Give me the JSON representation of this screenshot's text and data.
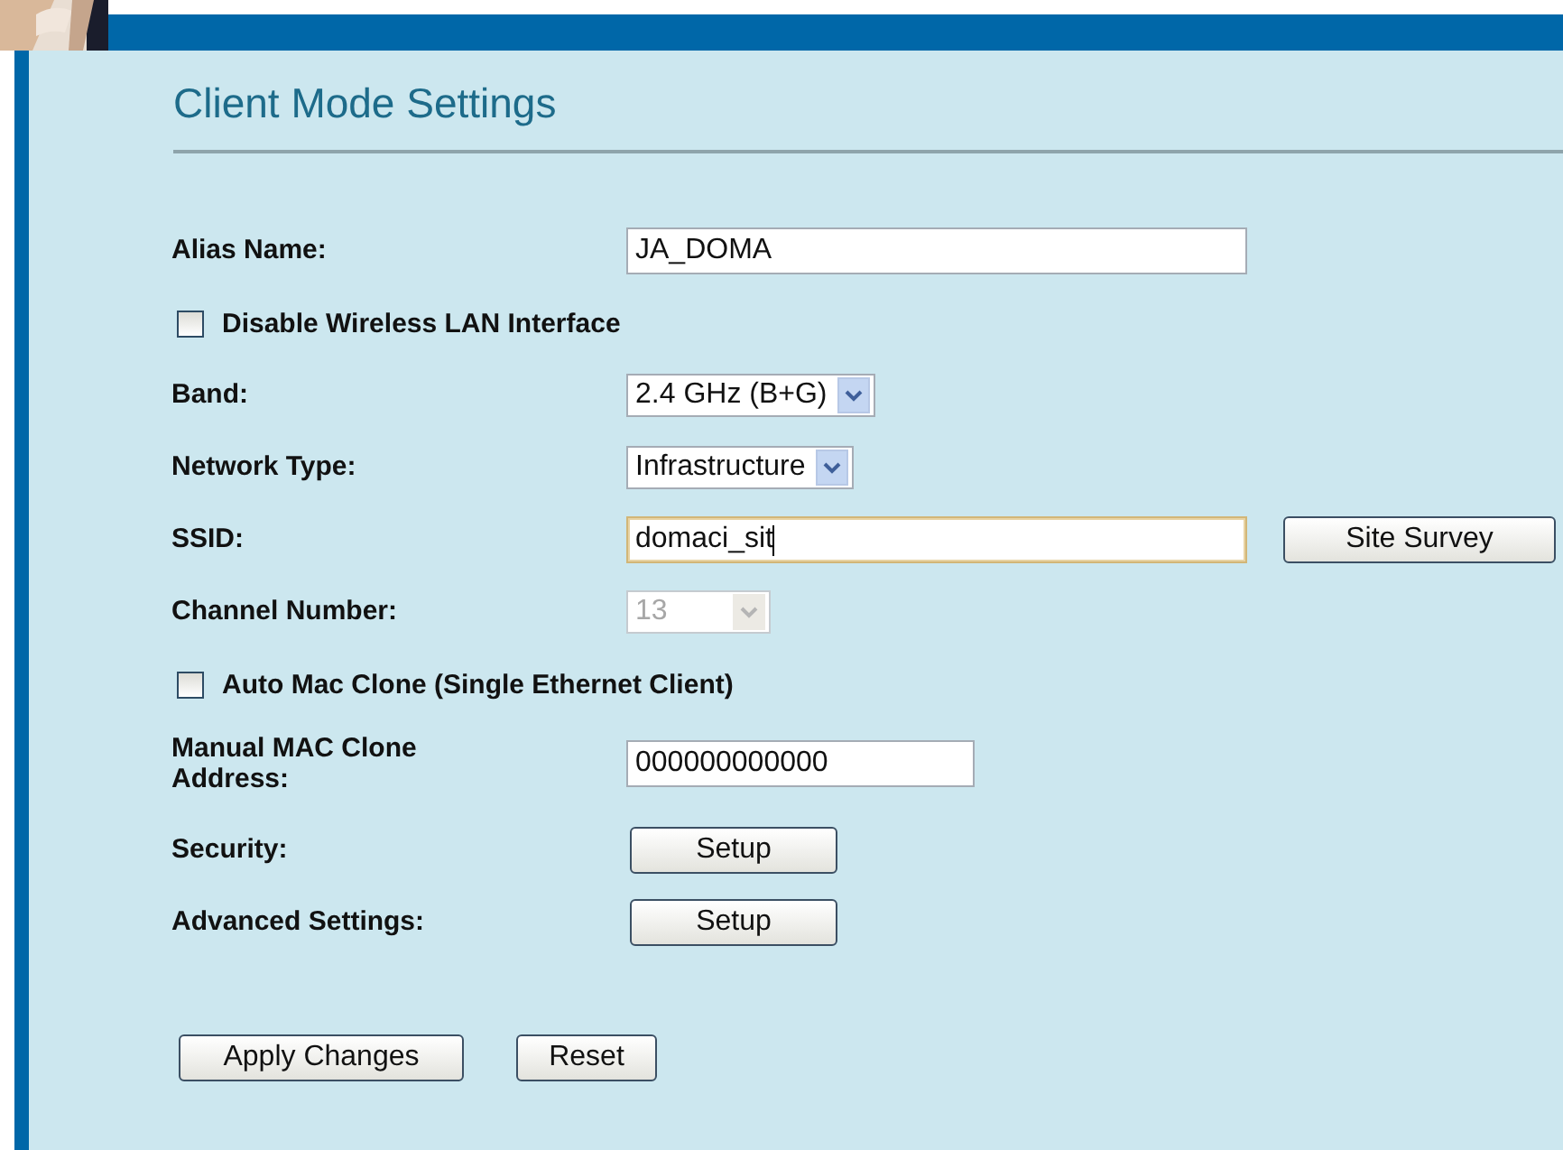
{
  "page": {
    "title": "Client Mode Settings"
  },
  "rows": [
    {
      "kind": "text",
      "label": "Alias Name:",
      "value": "JA_DOMA",
      "focused": false
    },
    {
      "kind": "checkbox",
      "label": "Disable Wireless LAN Interface",
      "checked": false
    },
    {
      "kind": "select",
      "label": "Band:",
      "value": "2.4 GHz (B+G)",
      "disabled": false
    },
    {
      "kind": "select",
      "label": "Network Type:",
      "value": "Infrastructure",
      "disabled": false
    },
    {
      "kind": "text",
      "label": "SSID:",
      "value": "domaci_sit",
      "focused": true,
      "button": "Site Survey"
    },
    {
      "kind": "select",
      "label": "Channel Number:",
      "value": "13",
      "disabled": true
    },
    {
      "kind": "checkbox",
      "label": "Auto Mac Clone (Single Ethernet Client)",
      "checked": false
    },
    {
      "kind": "short-text",
      "label": "Manual MAC Clone Address:",
      "value": "000000000000",
      "focused": false
    },
    {
      "kind": "button",
      "label": "Security:",
      "button": "Setup"
    },
    {
      "kind": "button",
      "label": "Advanced Settings:",
      "button": "Setup"
    }
  ],
  "actions": [
    "Apply Changes",
    "Reset"
  ]
}
